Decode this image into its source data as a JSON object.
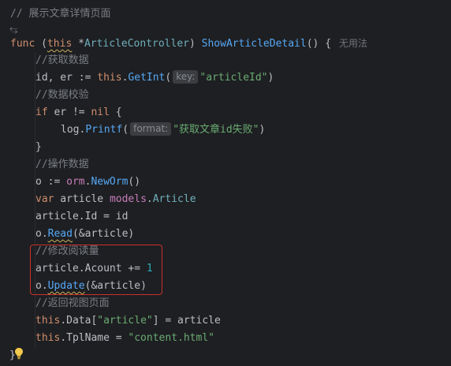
{
  "code": {
    "l1": "// 展示文章详情页面",
    "l2_glyph": "⥃",
    "l3": {
      "kw_func": "func",
      "open": " (",
      "this": "this",
      "star": " *",
      "type": "ArticleController",
      "close": ") ",
      "fname": "ShowArticleDetail",
      "sig_end": "() {",
      "unused": "无用法"
    },
    "l4": "//获取数据",
    "l5": {
      "vars": "id, er := ",
      "this": "this",
      "dot": ".",
      "call": "GetInt",
      "open": "(",
      "hint": "key:",
      "str": "\"articleId\"",
      "close": ")"
    },
    "l6": "//数据校验",
    "l7": {
      "kw_if": "if",
      "cond": " er != ",
      "kw_nil": "nil",
      "brace": " {"
    },
    "l8": {
      "pkg": "log",
      "dot": ".",
      "call": "Printf",
      "open": "(",
      "hint": "format:",
      "str": "\"获取文章id失败\"",
      "close": ")"
    },
    "l9": "}",
    "l10": "//操作数据",
    "l11": {
      "lhs": "o := ",
      "pkg": "orm",
      "dot": ".",
      "call": "NewOrm",
      "end": "()"
    },
    "l12": {
      "kw_var": "var",
      "name": " article ",
      "pkg": "models",
      "dot": ".",
      "type": "Article"
    },
    "l13": {
      "lhs": "article.Id = id"
    },
    "l14": {
      "obj": "o.",
      "call": "Read",
      "args": "(&article)"
    },
    "l15": "//修改阅读量",
    "l16": {
      "lhs": "article.Acount += ",
      "num": "1"
    },
    "l17": {
      "obj": "o.",
      "call": "Update",
      "args": "(&article)"
    },
    "l18": "//返回视图页面",
    "l19": {
      "this": "this",
      "rest": ".Data[",
      "str": "\"article\"",
      "end": "] = article"
    },
    "l20": {
      "this": "this",
      "rest": ".TplName = ",
      "str": "\"content.html\""
    },
    "l21": "}"
  },
  "colors": {
    "accent_box": "#c9302c",
    "bulb": "#f2c94c"
  },
  "icons": {
    "bulb": "lightbulb-icon"
  }
}
